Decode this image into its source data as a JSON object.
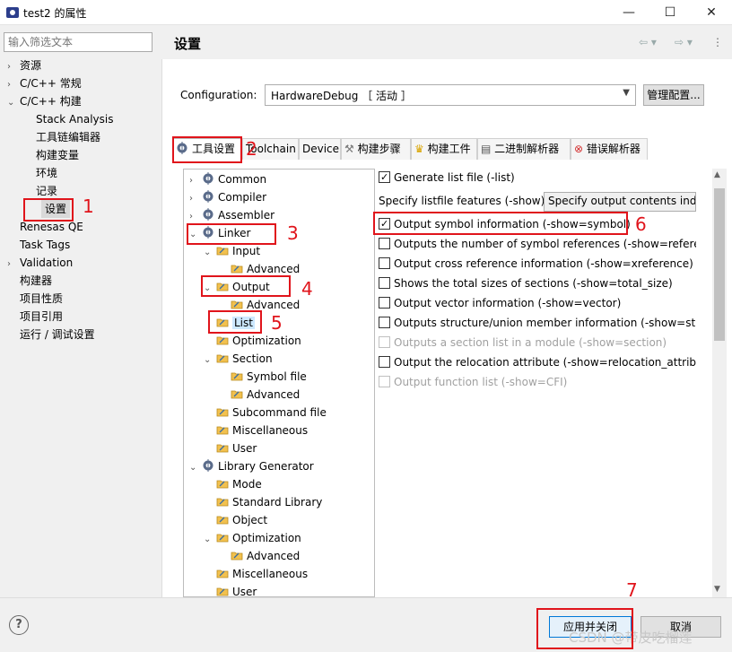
{
  "window": {
    "title": "test2 的属性",
    "minimize": "—",
    "maximize": "☐",
    "close": "✕"
  },
  "filter": {
    "placeholder": "输入筛选文本"
  },
  "nav": [
    {
      "label": "资源",
      "chevron": true,
      "indent": 0
    },
    {
      "label": "C/C++ 常规",
      "chevron": true,
      "indent": 0
    },
    {
      "label": "C/C++ 构建",
      "chevron": true,
      "indent": 0,
      "expanded": true
    },
    {
      "label": "Stack Analysis",
      "indent": 1
    },
    {
      "label": "工具链编辑器",
      "indent": 1
    },
    {
      "label": "构建变量",
      "indent": 1
    },
    {
      "label": "环境",
      "indent": 1
    },
    {
      "label": "记录",
      "indent": 1
    },
    {
      "label": "设置",
      "indent": 1,
      "selected": true
    },
    {
      "label": "Renesas QE",
      "indent": 0
    },
    {
      "label": "Task Tags",
      "indent": 0
    },
    {
      "label": "Validation",
      "chevron": true,
      "indent": 0
    },
    {
      "label": "构建器",
      "indent": 0
    },
    {
      "label": "项目性质",
      "indent": 0
    },
    {
      "label": "项目引用",
      "indent": 0
    },
    {
      "label": "运行 / 调试设置",
      "indent": 0
    }
  ],
  "main": {
    "title": "设置"
  },
  "config": {
    "label": "Configuration:",
    "value": "HardwareDebug ［ 活动 ］",
    "manage": "管理配置..."
  },
  "tabs": [
    {
      "label": "工具设置",
      "active": true
    },
    {
      "label": "Toolchain"
    },
    {
      "label": "Device"
    },
    {
      "label": "构建步骤"
    },
    {
      "label": "构建工件"
    },
    {
      "label": "二进制解析器"
    },
    {
      "label": "错误解析器"
    }
  ],
  "tree": [
    {
      "label": "Common",
      "level": 0,
      "chevron": "›",
      "icon": "gear"
    },
    {
      "label": "Compiler",
      "level": 0,
      "chevron": "›",
      "icon": "gear"
    },
    {
      "label": "Assembler",
      "level": 0,
      "chevron": "›",
      "icon": "gear"
    },
    {
      "label": "Linker",
      "level": 0,
      "chevron": "⌄",
      "icon": "gear"
    },
    {
      "label": "Input",
      "level": 1,
      "chevron": "⌄",
      "icon": "folder"
    },
    {
      "label": "Advanced",
      "level": 2,
      "icon": "folder"
    },
    {
      "label": "Output",
      "level": 1,
      "chevron": "⌄",
      "icon": "folder"
    },
    {
      "label": "Advanced",
      "level": 2,
      "icon": "folder"
    },
    {
      "label": "List",
      "level": 1,
      "icon": "folder",
      "selected": true
    },
    {
      "label": "Optimization",
      "level": 1,
      "icon": "folder"
    },
    {
      "label": "Section",
      "level": 1,
      "chevron": "⌄",
      "icon": "folder"
    },
    {
      "label": "Symbol file",
      "level": 2,
      "icon": "folder"
    },
    {
      "label": "Advanced",
      "level": 2,
      "icon": "folder"
    },
    {
      "label": "Subcommand file",
      "level": 1,
      "icon": "folder"
    },
    {
      "label": "Miscellaneous",
      "level": 1,
      "icon": "folder"
    },
    {
      "label": "User",
      "level": 1,
      "icon": "folder"
    },
    {
      "label": "Library Generator",
      "level": 0,
      "chevron": "⌄",
      "icon": "gear"
    },
    {
      "label": "Mode",
      "level": 1,
      "icon": "folder"
    },
    {
      "label": "Standard Library",
      "level": 1,
      "icon": "folder"
    },
    {
      "label": "Object",
      "level": 1,
      "icon": "folder"
    },
    {
      "label": "Optimization",
      "level": 1,
      "chevron": "⌄",
      "icon": "folder"
    },
    {
      "label": "Advanced",
      "level": 2,
      "icon": "folder"
    },
    {
      "label": "Miscellaneous",
      "level": 1,
      "icon": "folder"
    },
    {
      "label": "User",
      "level": 1,
      "icon": "folder"
    }
  ],
  "options": {
    "generate_list": "Generate list file (-list)",
    "specify_label": "Specify listfile features (-show)",
    "specify_value": "Specify output contents indiv",
    "items": [
      {
        "label": "Output symbol information (-show=symbol)",
        "checked": true
      },
      {
        "label": "Outputs the number of symbol references (-show=referen",
        "checked": false
      },
      {
        "label": "Output cross reference information (-show=xreference)",
        "checked": false
      },
      {
        "label": "Shows the total sizes of sections (-show=total_size)",
        "checked": false
      },
      {
        "label": "Output vector information (-show=vector)",
        "checked": false
      },
      {
        "label": "Outputs structure/union member information (-show=stru",
        "checked": false
      },
      {
        "label": "Outputs a section list in a module (-show=section)",
        "checked": false,
        "disabled": true
      },
      {
        "label": "Output the relocation attribute (-show=relocation_attribute",
        "checked": false
      },
      {
        "label": "Output function list (-show=CFI)",
        "checked": false,
        "disabled": true
      }
    ]
  },
  "buttons": {
    "help": "?",
    "apply": "应用并关闭",
    "cancel": "取消"
  },
  "annotations": [
    "1",
    "2",
    "3",
    "4",
    "5",
    "6",
    "7"
  ],
  "watermark": "CSDN @带皮吃榴莲",
  "colors": {
    "annotation": "#e0141b",
    "accent": "#0078d7"
  }
}
